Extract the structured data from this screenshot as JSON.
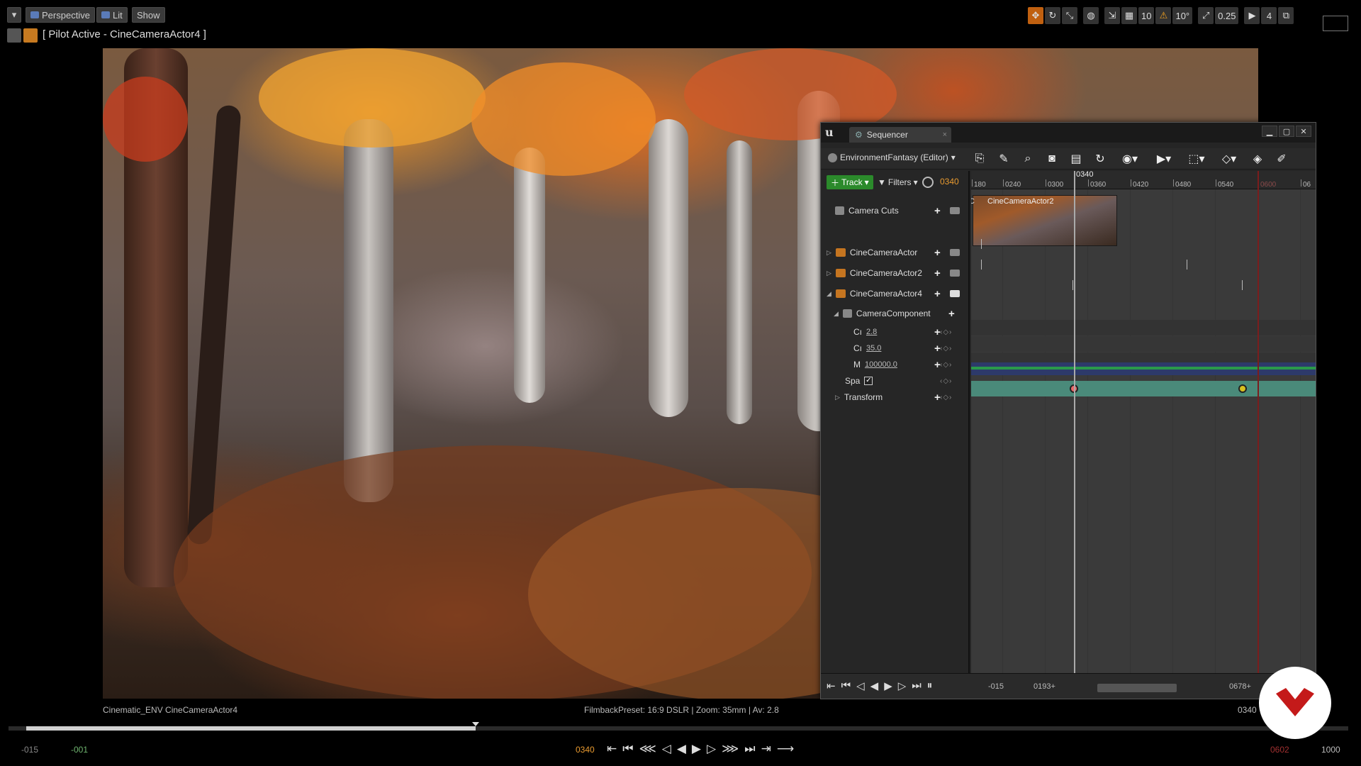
{
  "viewport_toolbar": {
    "dropdown_label": "▾",
    "perspective_label": "Perspective",
    "lit_label": "Lit",
    "show_label": "Show",
    "grid_snap": "10",
    "rotation_snap": "10°",
    "scale_snap": "0.25",
    "camera_speed": "4"
  },
  "pilot": {
    "label": "[ Pilot Active - CineCameraActor4 ]"
  },
  "scene_captions": {
    "left": "Cinematic_ENV  CineCameraActor4",
    "middle": "FilmbackPreset: 16:9 DSLR | Zoom: 35mm | Av: 2.8",
    "right": "0340"
  },
  "bottom_timeline": {
    "start": "-015",
    "start2": "-001",
    "current": "0340",
    "end_red": "0602",
    "end": "1000",
    "progress": 0.34
  },
  "sequencer": {
    "tab_title": "Sequencer",
    "tab_close": "×",
    "level": "EnvironmentFantasy (Editor)",
    "track_btn": "Track",
    "filters_btn": "Filters",
    "current_frame": "0340",
    "playhead_label": "0340",
    "ruler_ticks": [
      "180",
      "0240",
      "0300",
      "0360",
      "0420",
      "0480",
      "0540",
      "0600",
      "06"
    ],
    "shot": {
      "prefix": "C",
      "name": "CineCameraActor2"
    },
    "tracks": [
      {
        "label": "Camera Cuts"
      },
      {
        "label": "CineCameraActor"
      },
      {
        "label": "CineCameraActor2"
      },
      {
        "label": "CineCameraActor4"
      },
      {
        "label": "CameraComponent"
      },
      {
        "label": "Cı",
        "value": "2.8"
      },
      {
        "label": "Cı",
        "value": "35.0"
      },
      {
        "label": "M",
        "value": "100000.0"
      },
      {
        "label": "Spa"
      },
      {
        "label": "Transform"
      }
    ],
    "range_start": "-015",
    "range_view_start": "0193+",
    "range_view_end": "0678+"
  },
  "colors": {
    "track_green": "#2b8a2b",
    "frame_orange": "#e89a30",
    "transform_lane": "#4a8a7a",
    "end_marker": "#7a1d1d"
  }
}
